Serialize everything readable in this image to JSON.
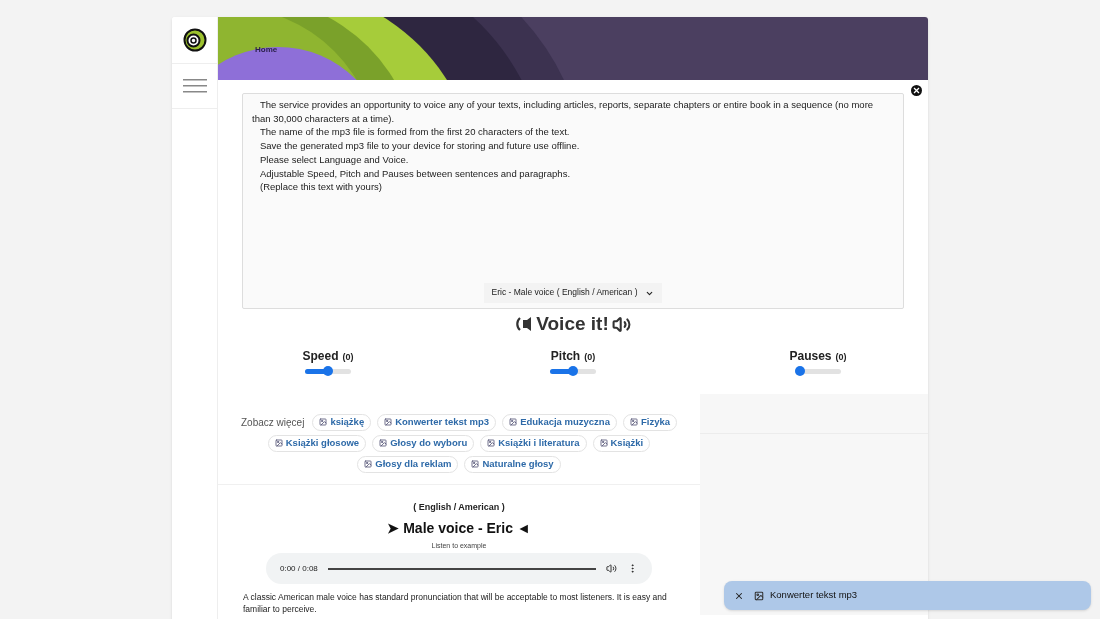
{
  "header": {
    "nav_link": "Home"
  },
  "text_area": {
    "lines": [
      "The service provides an opportunity to voice any of your texts, including articles, reports, separate chapters or entire book in a sequence (no more than 30,000 characters at a time).",
      "The name of the mp3 file is formed from the first 20 characters of the text.",
      "Save the generated mp3 file to your device for storing and future use offline.",
      "Please select Language and Voice.",
      "Adjustable Speed, Pitch and Pauses between sentences and paragraphs.",
      "(Replace this text with yours)"
    ],
    "voice_select": "Eric - Male voice ( English / American )"
  },
  "voice_button": "Voice it!",
  "sliders": [
    {
      "label": "Speed",
      "reading": "(0)",
      "level": 0.5
    },
    {
      "label": "Pitch",
      "reading": "(0)",
      "level": 0.5
    },
    {
      "label": "Pauses",
      "reading": "(0)",
      "level": 0
    }
  ],
  "see_more": {
    "label": "Zobacz więcej",
    "tags": [
      "książkę",
      "Konwerter tekst mp3",
      "Edukacja muzyczna",
      "Fizyka",
      "Książki głosowe",
      "Głosy do wyboru",
      "Książki i literatura",
      "Książki",
      "Głosy dla reklam",
      "Naturalne głosy"
    ]
  },
  "voice_info": {
    "language": "( English / American )",
    "title": "➤ Male voice - Eric ◄",
    "listen_label": "Listen to example",
    "player_time": "0:00 / 0:08",
    "description": "A classic American male voice has standard pronunciation that will be acceptable to most listeners. It is easy and familiar to perceive."
  },
  "toast": {
    "text": "Konwerter tekst mp3"
  }
}
